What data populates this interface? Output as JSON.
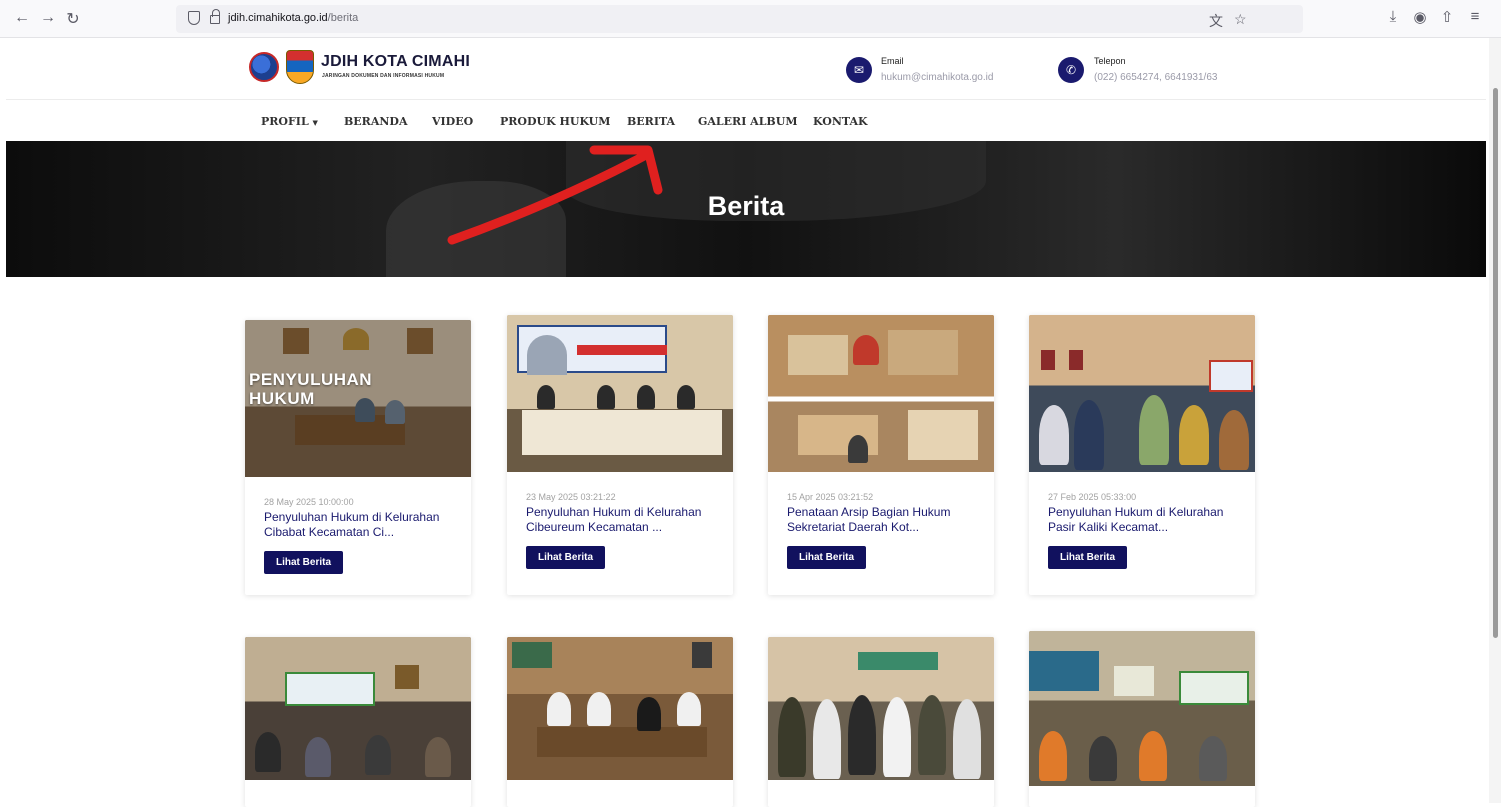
{
  "browser": {
    "url_host": "jdih.cimahikota.go.id",
    "url_path": "/berita"
  },
  "site": {
    "title": "JDIH KOTA CIMAHI",
    "subtitle": "JARINGAN DOKUMEN DAN INFORMASI HUKUM",
    "email_label": "Email",
    "email_value": "hukum@cimahikota.go.id",
    "phone_label": "Telepon",
    "phone_value": "(022) 6654274, 6641931/63"
  },
  "nav": {
    "items": [
      "PROFIL",
      "BERANDA",
      "VIDEO",
      "PRODUK HUKUM",
      "BERITA",
      "GALERI ALBUM",
      "KONTAK"
    ]
  },
  "hero": {
    "title": "Berita"
  },
  "cards": [
    {
      "date": "28 May 2025 10:00:00",
      "title": "Penyuluhan Hukum di Kelurahan Cibabat Kecamatan Ci...",
      "button": "Lihat Berita",
      "overlay": "PENYULUHAN HUKUM"
    },
    {
      "date": "23 May 2025 03:21:22",
      "title": "Penyuluhan Hukum di Kelurahan Cibeureum Kecamatan ...",
      "button": "Lihat Berita"
    },
    {
      "date": "15 Apr 2025 03:21:52",
      "title": "Penataan Arsip Bagian Hukum Sekretariat Daerah Kot...",
      "button": "Lihat Berita"
    },
    {
      "date": "27 Feb 2025 05:33:00",
      "title": "Penyuluhan Hukum di Kelurahan Pasir Kaliki Kecamat...",
      "button": "Lihat Berita"
    }
  ],
  "colors": {
    "brand_navy": "#11115e",
    "annotation_red": "#e0201f"
  }
}
